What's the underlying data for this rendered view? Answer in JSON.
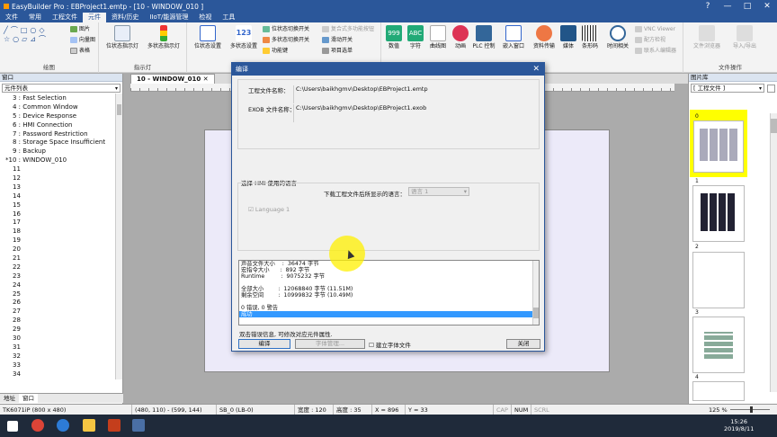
{
  "window": {
    "title": "EasyBuilder Pro : EBProject1.emtp - [10 - WINDOW_010 ]"
  },
  "menu": [
    "文件",
    "常用",
    "工程文件",
    "元件",
    "资料/历史",
    "IIoT/能源管理",
    "检视",
    "工具"
  ],
  "menu_active": "元件",
  "ribbon": {
    "draw_group": "绘图",
    "draw_small": [
      "图片",
      "向量图",
      "表格"
    ],
    "indicator_group": "指示灯",
    "indicator_btns": [
      "位状态指示灯",
      "多状态指示灯"
    ],
    "switch_btns": [
      "位状态设置",
      "多状态设置"
    ],
    "switch_small": [
      "位状态切换开关",
      "多状态切换开关",
      "功能键",
      "复合式多功能按钮",
      "滑动开关",
      "项目选单"
    ],
    "other_group": "其他",
    "other_btns": [
      "数值",
      "字符",
      "曲线图",
      "动画",
      "PLC 控制",
      "嵌入窗口",
      "资料传输",
      "媒体",
      "条形码",
      "时间相关"
    ],
    "other_small": [
      "VNC Viewer",
      "配方检视",
      "联系人编辑器"
    ],
    "file_group": "文件操作",
    "file_btns": [
      "文件浏览器",
      "导入/导出"
    ]
  },
  "left_panel": {
    "header": "窗口",
    "combo": "元件列表",
    "items": [
      "3 : Fast Selection",
      "4 : Common Window",
      "5 : Device Response",
      "6 : HMI Connection",
      "7 : Password Restriction",
      "8 : Storage Space Insufficient",
      "9 : Backup",
      "*10 : WINDOW_010",
      "11",
      "12",
      "13",
      "14",
      "15",
      "16",
      "17",
      "18",
      "19",
      "20",
      "21",
      "22",
      "23",
      "24",
      "25",
      "26",
      "27",
      "28",
      "29",
      "30",
      "31",
      "32",
      "33",
      "34"
    ],
    "tabs": [
      "地址",
      "窗口"
    ]
  },
  "doc_tab": "10 - WINDOW_010",
  "dialog": {
    "title": "编译",
    "project_label": "工程文件名称：",
    "project_value": "C:\\Users\\baikhgmv\\Desktop\\EBProject1.emtp",
    "exob_label": "EXOB 文件名称：",
    "exob_value": "C:\\Users\\baikhgmv\\Desktop\\EBProject1.exob",
    "lang_section": "选择 HMI 使用的语言",
    "lang_download_label": "下载工程文件后所显示的语言：",
    "lang_select": "语言 1",
    "lang_check": "Language 1",
    "log": [
      "声音文件大小    :  36474 字节",
      "宏指令大小      :  892 字节",
      "Runtime         :  9075232 字节",
      "",
      "全部大小        :  12068840 字节 (11.51M)",
      "剩余空间        :  10999832 字节 (10.49M)",
      "",
      "0 错误, 0 警告"
    ],
    "log_selected": "成功",
    "hint": "双击错误信息, 可修改对应元件属性.",
    "btn_compile": "编译",
    "btn_font": "字体管理...",
    "chk_font": "建立字体文件",
    "btn_close": "关闭"
  },
  "right_panel": {
    "header": "图片库",
    "combo": "[ 工程文件 ]",
    "thumbs": [
      "0",
      "1",
      "2",
      "3",
      "4"
    ]
  },
  "status": {
    "model": "TK6071iP (800 x 480)",
    "pos": "(480, 110) - (599, 144)",
    "sel": "SB_0 (LB-0)",
    "width": "宽度 : 120",
    "height": "高度 : 35",
    "x": "X = 896",
    "y": "Y = 33",
    "cap": "CAP",
    "num": "NUM",
    "scrl": "SCRL",
    "zoom": "125 %"
  },
  "taskbar": {
    "time": "15:26",
    "date": "2019/8/11"
  },
  "colors": {
    "accent": "#2b579a",
    "selection": "#3399ff",
    "halo": "#fff000"
  }
}
